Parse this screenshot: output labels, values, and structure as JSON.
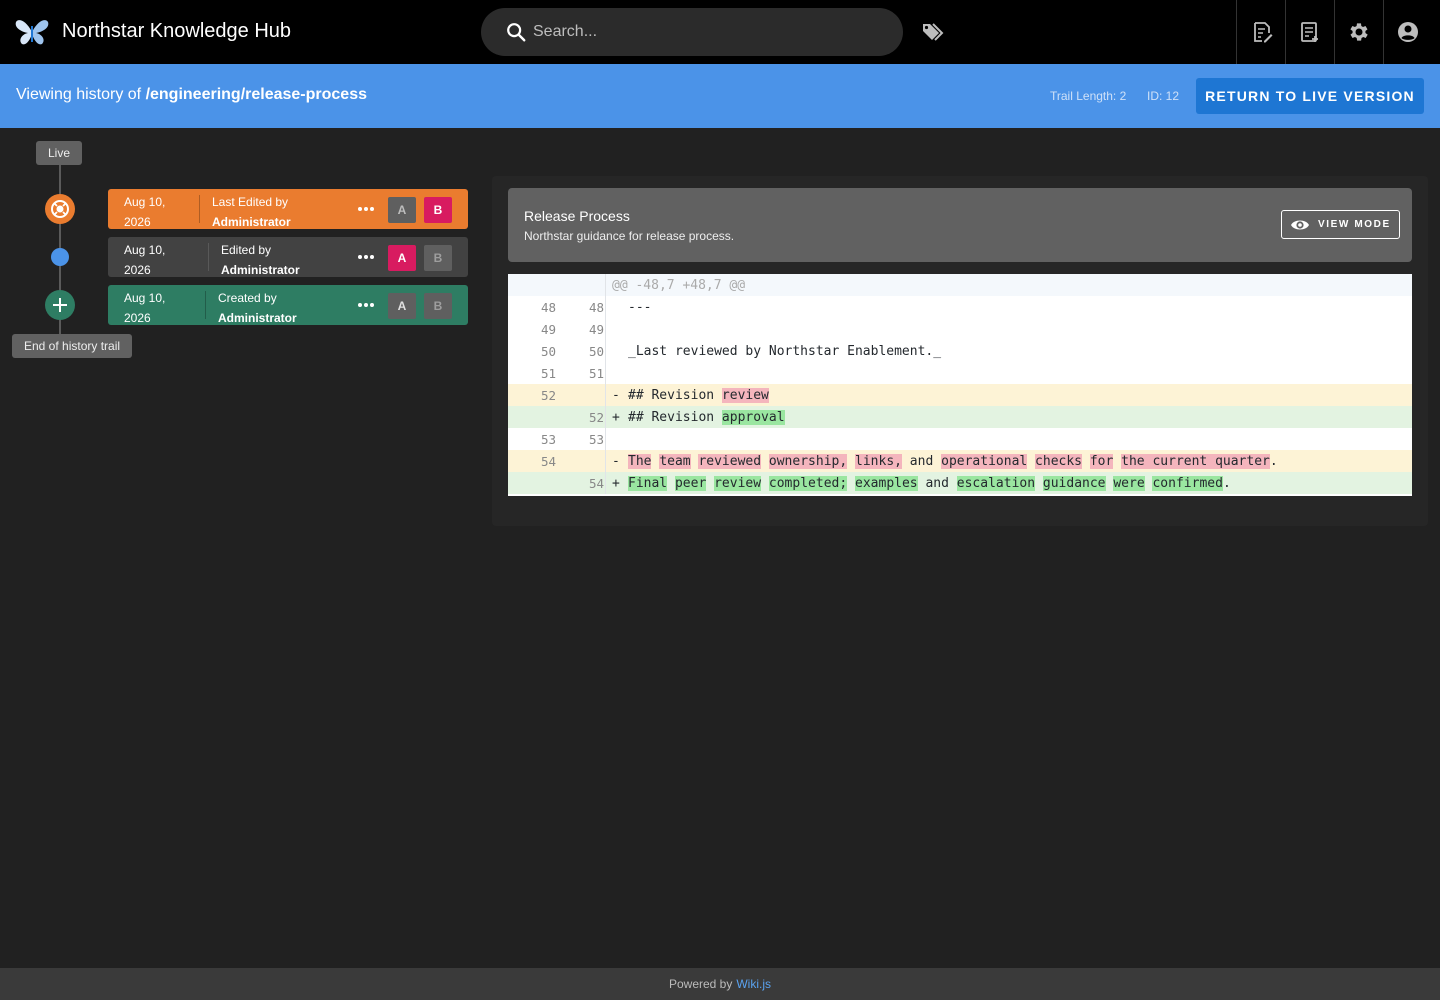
{
  "app": {
    "title": "Northstar Knowledge Hub",
    "search_placeholder": "Search..."
  },
  "topbar_icons": [
    "tags-icon",
    "new-page-icon",
    "page-actions-icon",
    "admin-gear-icon",
    "account-icon"
  ],
  "history_header": {
    "viewing_prefix": "Viewing history of",
    "path": "/engineering/release-process",
    "trail_length": "Trail Length: 2",
    "id": "ID: 12",
    "return_label": "RETURN TO LIVE VERSION"
  },
  "timeline": {
    "live_label": "Live",
    "end_label": "End of history trail",
    "entries": [
      {
        "date_line1": "Aug 10,",
        "date_line2": "2026",
        "action": "Last Edited by",
        "author": "Administrator",
        "color": "#ea7c2f",
        "a_label": "A",
        "b_label": "B",
        "a_active": false,
        "b_active": true
      },
      {
        "date_line1": "Aug 10,",
        "date_line2": "2026",
        "action": "Edited by",
        "author": "Administrator",
        "color": "#424242",
        "a_label": "A",
        "b_label": "B",
        "a_active": true,
        "b_active": false
      },
      {
        "date_line1": "Aug 10,",
        "date_line2": "2026",
        "action": "Created by",
        "author": "Administrator",
        "color": "#2e7d63",
        "a_label": "A",
        "b_label": "B",
        "a_active": false,
        "b_active": false
      }
    ]
  },
  "page_card": {
    "title": "Release Process",
    "description": "Northstar guidance for release process.",
    "view_mode_label": "VIEW MODE"
  },
  "diff": {
    "hunk_header": "@@ -48,7 +48,7 @@",
    "lines": [
      {
        "type": "ctx",
        "old": "48",
        "new": "48",
        "text": "---"
      },
      {
        "type": "ctx",
        "old": "49",
        "new": "49",
        "text": ""
      },
      {
        "type": "ctx",
        "old": "50",
        "new": "50",
        "text": "_Last reviewed by Northstar Enablement._"
      },
      {
        "type": "ctx",
        "old": "51",
        "new": "51",
        "text": ""
      },
      {
        "type": "del",
        "old": "52",
        "new": "",
        "sign": "-",
        "segments": [
          {
            "t": "## Revision ",
            "m": false
          },
          {
            "t": "review",
            "m": true
          }
        ]
      },
      {
        "type": "add",
        "old": "",
        "new": "52",
        "sign": "+",
        "segments": [
          {
            "t": "## Revision ",
            "m": false
          },
          {
            "t": "approval",
            "m": true
          }
        ]
      },
      {
        "type": "ctx",
        "old": "53",
        "new": "53",
        "text": ""
      },
      {
        "type": "del",
        "old": "54",
        "new": "",
        "sign": "-",
        "segments": [
          {
            "t": "The",
            "m": true
          },
          {
            "t": " ",
            "m": false
          },
          {
            "t": "team",
            "m": true
          },
          {
            "t": " ",
            "m": false
          },
          {
            "t": "reviewed",
            "m": true
          },
          {
            "t": " ",
            "m": false
          },
          {
            "t": "ownership,",
            "m": true
          },
          {
            "t": " ",
            "m": false
          },
          {
            "t": "links,",
            "m": true
          },
          {
            "t": " and ",
            "m": false
          },
          {
            "t": "operational",
            "m": true
          },
          {
            "t": " ",
            "m": false
          },
          {
            "t": "checks",
            "m": true
          },
          {
            "t": " ",
            "m": false
          },
          {
            "t": "for",
            "m": true
          },
          {
            "t": " ",
            "m": false
          },
          {
            "t": "the current quarter",
            "m": true
          },
          {
            "t": ".",
            "m": false
          }
        ]
      },
      {
        "type": "add",
        "old": "",
        "new": "54",
        "sign": "+",
        "segments": [
          {
            "t": "Final",
            "m": true
          },
          {
            "t": " ",
            "m": false
          },
          {
            "t": "peer",
            "m": true
          },
          {
            "t": " ",
            "m": false
          },
          {
            "t": "review",
            "m": true
          },
          {
            "t": " ",
            "m": false
          },
          {
            "t": "completed;",
            "m": true
          },
          {
            "t": " ",
            "m": false
          },
          {
            "t": "examples",
            "m": true
          },
          {
            "t": " and ",
            "m": false
          },
          {
            "t": "escalation",
            "m": true
          },
          {
            "t": " ",
            "m": false
          },
          {
            "t": "guidance",
            "m": true
          },
          {
            "t": " ",
            "m": false
          },
          {
            "t": "were",
            "m": true
          },
          {
            "t": " ",
            "m": false
          },
          {
            "t": "confirmed",
            "m": true
          },
          {
            "t": ".",
            "m": false
          }
        ]
      }
    ]
  },
  "footer": {
    "prefix": "Powered by",
    "link": "Wiki.js"
  }
}
